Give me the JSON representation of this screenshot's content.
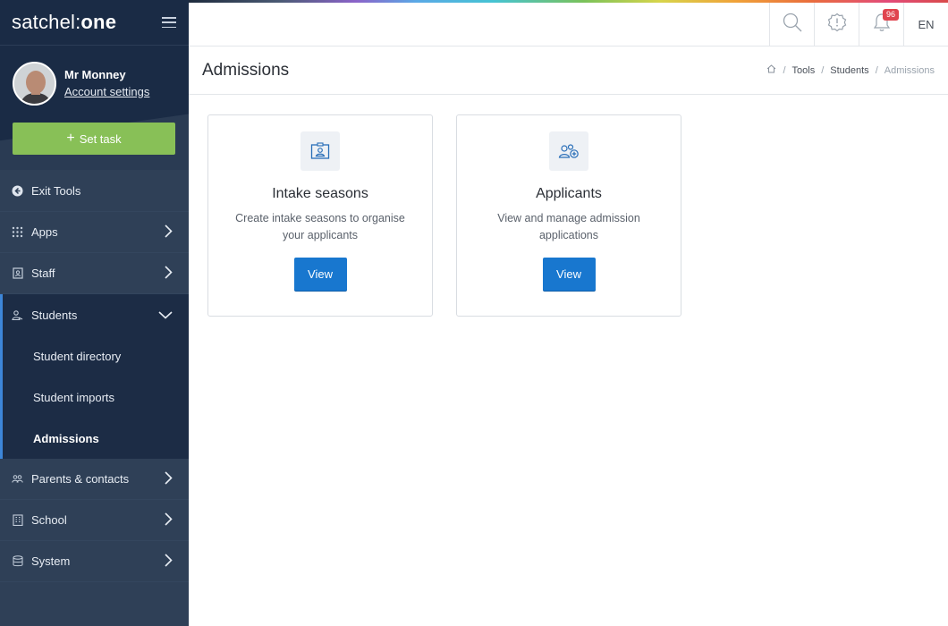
{
  "app": {
    "brand_light": "satchel",
    "brand_colon": ":",
    "brand_bold": "one"
  },
  "user": {
    "name": "Mr Monney",
    "account_link": "Account settings"
  },
  "sidebar": {
    "set_task_label": "Set task",
    "items": [
      {
        "label": "Exit Tools",
        "icon": "arrow-left-circle-icon"
      },
      {
        "label": "Apps",
        "icon": "grid-icon"
      },
      {
        "label": "Staff",
        "icon": "id-badge-icon"
      },
      {
        "label": "Students",
        "icon": "students-icon"
      },
      {
        "label": "Parents & contacts",
        "icon": "contacts-icon"
      },
      {
        "label": "School",
        "icon": "building-icon"
      },
      {
        "label": "System",
        "icon": "database-icon"
      }
    ],
    "students_sub": [
      {
        "label": "Student directory"
      },
      {
        "label": "Student imports"
      },
      {
        "label": "Admissions"
      }
    ]
  },
  "topbar": {
    "notification_count": "96",
    "language": "EN"
  },
  "header": {
    "title": "Admissions",
    "breadcrumb": [
      "Tools",
      "Students",
      "Admissions"
    ]
  },
  "cards": [
    {
      "title": "Intake seasons",
      "description": "Create intake seasons to organise your applicants",
      "button": "View",
      "icon": "id-card-icon"
    },
    {
      "title": "Applicants",
      "description": "View and manage admission applications",
      "button": "View",
      "icon": "applicants-icon"
    }
  ],
  "colors": {
    "sidebar": "#2f4057",
    "sidebar_dark": "#1a2b45",
    "accent_green": "#88c057",
    "primary_blue": "#1877cf",
    "badge_red": "#e0454f"
  }
}
